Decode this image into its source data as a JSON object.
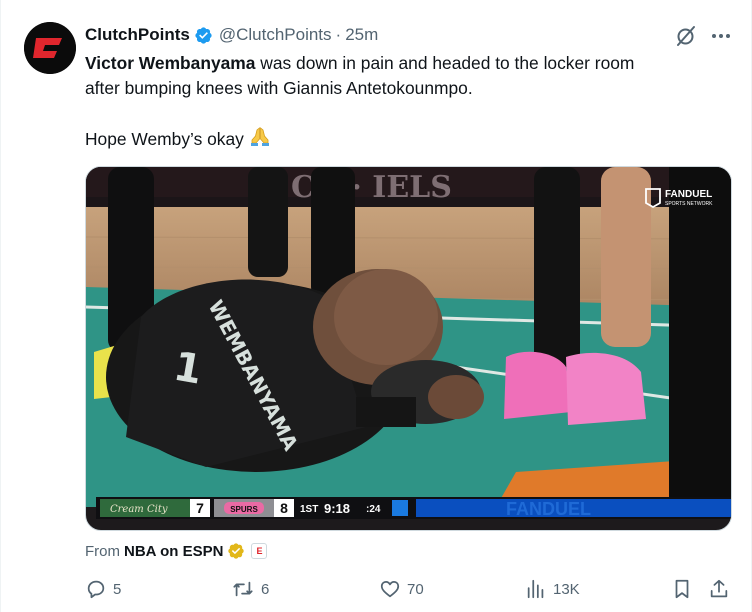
{
  "post": {
    "author_name": "ClutchPoints",
    "handle": "@ClutchPoints",
    "separator": "·",
    "time": "25m",
    "text_bold": "Victor Wembanyama",
    "text_line1_rest": " was down in pain and headed to the locker room",
    "text_line2": "after bumping knees with Giannis Antetokounmpo.",
    "text_line3": "Hope Wemby’s okay ",
    "emoji": "folded-hands"
  },
  "media": {
    "broadcast_logo_line1": "FANDUEL",
    "broadcast_logo_line2": "SPORTS NETWORK",
    "jersey_name": "WEMBANYAMA",
    "jersey_number": "1",
    "scorebug": {
      "away_team": "Cream City",
      "away_score": "7",
      "home_team": "SPURS",
      "home_score": "8",
      "quarter": "1ST",
      "clock": "9:18",
      "shot_clock": ":24",
      "banner": "FANDUEL"
    }
  },
  "attribution": {
    "label": "From",
    "source": "NBA on ESPN",
    "source_badge": "E"
  },
  "actions": {
    "replies": "5",
    "reposts": "6",
    "likes": "70",
    "views": "13K"
  },
  "colors": {
    "verified_blue": "#1d9bf0",
    "gold_badge": "#e2b719",
    "text_secondary": "#536471",
    "brand_red": "#e0262d"
  },
  "icons": [
    "clutchpoints-logo",
    "verified-badge-icon",
    "grok-icon",
    "more-icon",
    "folded-hands-emoji",
    "gold-check-icon",
    "reply-icon",
    "repost-icon",
    "like-icon",
    "views-icon",
    "bookmark-icon",
    "share-icon"
  ]
}
